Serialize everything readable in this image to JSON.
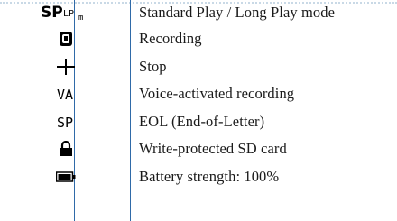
{
  "rows": [
    {
      "icon": "sp-lp-mode-icon",
      "description": "Standard Play / Long Play mode"
    },
    {
      "icon": "recording-icon",
      "description": "Recording"
    },
    {
      "icon": "stop-icon",
      "description": "Stop"
    },
    {
      "icon": "va-icon",
      "icon_text": "VA",
      "description": "Voice-activated recording"
    },
    {
      "icon": "eol-icon",
      "icon_text": "SP",
      "description": "EOL (End-of-Letter)"
    },
    {
      "icon": "lock-icon",
      "description": "Write-protected SD card"
    },
    {
      "icon": "battery-icon",
      "description": "Battery strength: 100%"
    }
  ],
  "sp_lp_icon": {
    "big": "SP",
    "small": "LP",
    "sub": "m"
  },
  "colors": {
    "divider": "#2f6aa8",
    "top_rule": "#c9d9e6"
  }
}
